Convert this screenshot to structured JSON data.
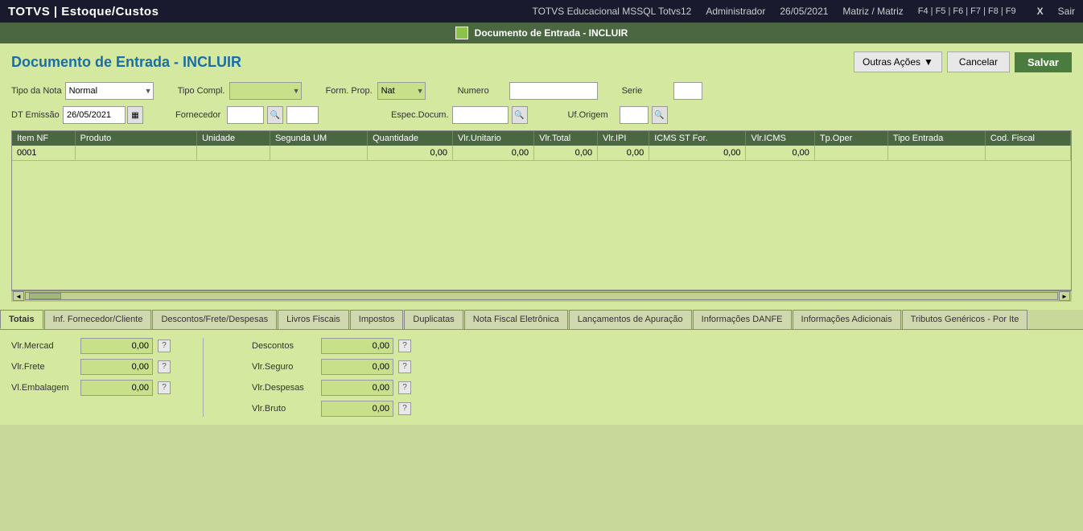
{
  "topbar": {
    "title": "TOTVS | Estoque/Custos",
    "system": "TOTVS Educacional MSSQL Totvs12",
    "user": "Administrador",
    "date": "26/05/2021",
    "branch": "Matriz / Matriz",
    "fkeys": "F4 | F5 | F6 | F7 | F8 | F9",
    "close_label": "X",
    "exit_label": "Sair"
  },
  "modal": {
    "title": "Documento de Entrada - INCLUIR"
  },
  "page": {
    "title": "Documento de Entrada - INCLUIR"
  },
  "buttons": {
    "outras_acoes": "Outras Ações",
    "cancelar": "Cancelar",
    "salvar": "Salvar"
  },
  "form": {
    "tipo_da_nota_label": "Tipo da Nota",
    "tipo_da_nota_value": "Normal",
    "tipo_compl_label": "Tipo Compl.",
    "form_prop_label": "Form. Prop.",
    "form_prop_value": "Nat",
    "numero_label": "Numero",
    "serie_label": "Serie",
    "dt_emissao_label": "DT Emissão",
    "dt_emissao_value": "26/05/2021",
    "fornecedor_label": "Fornecedor",
    "espec_docum_label": "Espec.Docum.",
    "uf_origem_label": "Uf.Origem"
  },
  "table": {
    "headers": [
      "Item NF",
      "Produto",
      "Unidade",
      "Segunda UM",
      "Quantidade",
      "Vlr.Unitario",
      "Vlr.Total",
      "Vlr.IPI",
      "ICMS ST For.",
      "Vlr.ICMS",
      "Tp.Oper",
      "Tipo Entrada",
      "Cod. Fiscal"
    ],
    "row": {
      "item_nf": "0001",
      "produto": "",
      "unidade": "",
      "segunda_um": "",
      "quantidade": "0,00",
      "vlr_unitario": "0,00",
      "vlr_total": "0,00",
      "vlr_ipi": "0,00",
      "icms_st_for": "0,00",
      "vlr_icms": "0,00",
      "tp_oper": "",
      "tipo_entrada": "",
      "cod_fiscal": ""
    }
  },
  "tabs": [
    {
      "label": "Totais",
      "active": true
    },
    {
      "label": "Inf. Fornecedor/Cliente",
      "active": false
    },
    {
      "label": "Descontos/Frete/Despesas",
      "active": false
    },
    {
      "label": "Livros Fiscais",
      "active": false
    },
    {
      "label": "Impostos",
      "active": false
    },
    {
      "label": "Duplicatas",
      "active": false
    },
    {
      "label": "Nota Fiscal Eletrônica",
      "active": false
    },
    {
      "label": "Lançamentos de Apuração",
      "active": false
    },
    {
      "label": "Informações DANFE",
      "active": false
    },
    {
      "label": "Informações Adicionais",
      "active": false
    },
    {
      "label": "Tributos Genéricos - Por Ite",
      "active": false
    }
  ],
  "totals": {
    "left": [
      {
        "label": "Vlr.Mercad",
        "value": "0,00"
      },
      {
        "label": "Vlr.Frete",
        "value": "0,00"
      },
      {
        "label": "Vl.Embalagem",
        "value": "0,00"
      }
    ],
    "right": [
      {
        "label": "Descontos",
        "value": "0,00"
      },
      {
        "label": "Vlr.Seguro",
        "value": "0,00"
      },
      {
        "label": "Vlr.Despesas",
        "value": "0,00"
      },
      {
        "label": "Vlr.Bruto",
        "value": "0,00"
      }
    ]
  },
  "icons": {
    "dropdown_arrow": "▼",
    "calendar": "▦",
    "search": "🔍",
    "help": "?",
    "move": "⊕",
    "scroll_left": "◄",
    "scroll_right": "►"
  }
}
